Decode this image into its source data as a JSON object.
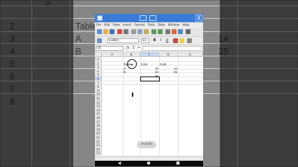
{
  "background": {
    "col_header": "A",
    "row_numbers": [
      "2",
      "3",
      "4",
      "5",
      "6",
      "7",
      "8"
    ],
    "cells": {
      "table_label": "Table",
      "a": "A",
      "b": "B",
      "v1": "14",
      "v2": "25"
    }
  },
  "window": {
    "title": "",
    "close_label": "X",
    "colors": {
      "titlebar": "#3a7bd5",
      "selection": "#c7d6ee"
    }
  },
  "menu": [
    "File",
    "Edit",
    "View",
    "Insert",
    "Format",
    "Tools",
    "Data",
    "Window",
    "Help"
  ],
  "fontbar": {
    "font_name": "Calibri",
    "font_size": "11"
  },
  "formula": {
    "cell_ref": "C6",
    "content": ""
  },
  "columns": [
    "A",
    "B",
    "C",
    "D",
    "E"
  ],
  "rows": [
    "1",
    "2",
    "3",
    "4",
    "5",
    "6",
    "7",
    "8",
    "9",
    "10",
    "11",
    "12",
    "13",
    "14",
    "15",
    "16",
    "17",
    "18",
    "19",
    "20",
    "21",
    "22",
    "23",
    "24",
    "25",
    "26"
  ],
  "sheet": {
    "b2": "Table",
    "c2": "Col1",
    "d2": "Col2",
    "b3": "A",
    "c3": "12",
    "d3": "14",
    "b4": "B",
    "c4": "23",
    "d4": "25",
    "c5": "35"
  },
  "toast": "Autofill",
  "navbar": {
    "back": "back-icon",
    "home": "home-icon",
    "recents": "recents-icon"
  }
}
